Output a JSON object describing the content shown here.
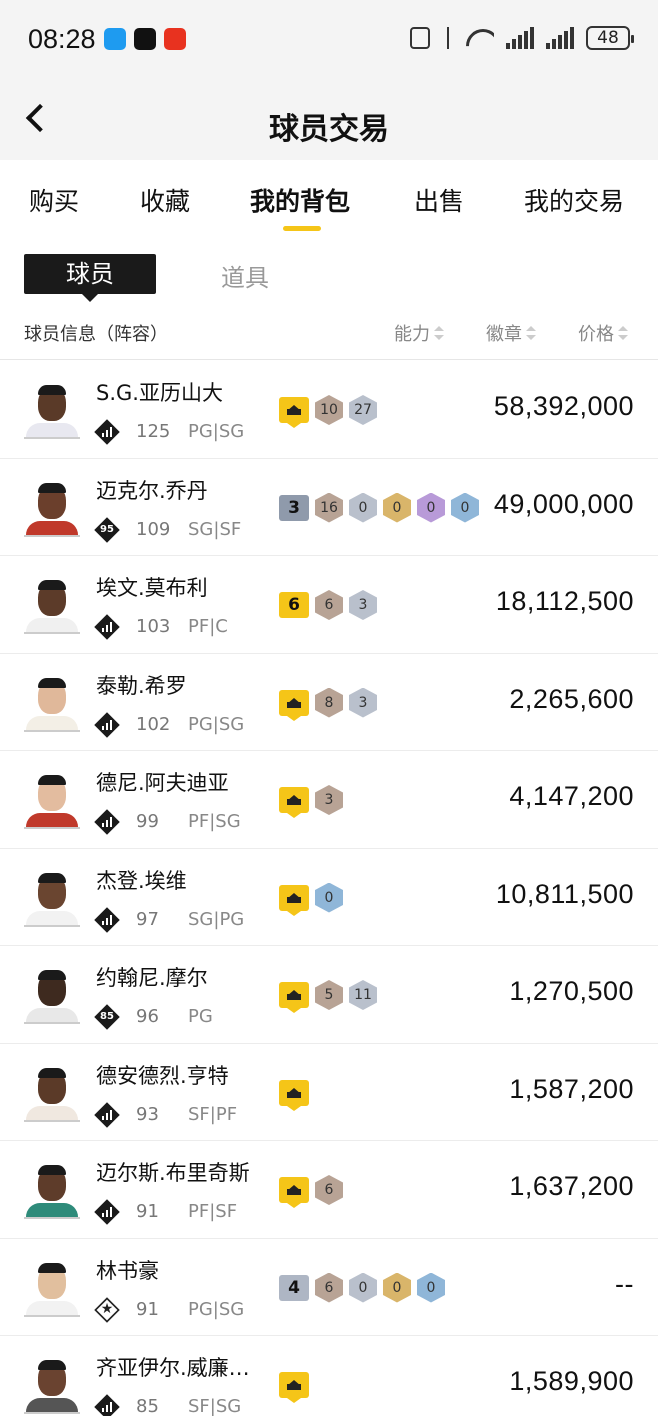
{
  "status_bar": {
    "time": "08:28",
    "battery": "48",
    "icons": [
      "message-app-icon",
      "tiktok-icon",
      "news-app-icon",
      "nfc-icon",
      "bluetooth-icon",
      "wifi-icon",
      "signal-icon",
      "signal-icon",
      "battery-icon"
    ]
  },
  "header": {
    "title": "球员交易",
    "back_icon": "chevron-left-icon"
  },
  "tabs": [
    {
      "label": "购买",
      "active": false
    },
    {
      "label": "收藏",
      "active": false
    },
    {
      "label": "我的背包",
      "active": true
    },
    {
      "label": "出售",
      "active": false
    },
    {
      "label": "我的交易",
      "active": false
    }
  ],
  "subtabs": {
    "players": "球员",
    "items": "道具",
    "selected": "球员"
  },
  "columns": {
    "info": "球员信息（阵容）",
    "ability": "能力",
    "badges": "徽章",
    "price": "价格"
  },
  "colors": {
    "accent": "#f5c518",
    "text": "#111111",
    "muted": "#888888",
    "divider": "#ececec"
  },
  "players": [
    {
      "name": "S.G.亚历山大",
      "ovr": "125",
      "pos": "PG|SG",
      "rank": "bars",
      "tier": "crown",
      "badges": [
        {
          "t": "bronze",
          "v": "10"
        },
        {
          "t": "silver",
          "v": "27"
        }
      ],
      "price": "58,392,000",
      "skin": "#5a3a28",
      "shirt": "#e8e8f0"
    },
    {
      "name": "迈克尔.乔丹",
      "ovr": "109",
      "pos": "SG|SF",
      "rank": "95",
      "tier": "3",
      "badges": [
        {
          "t": "bronze",
          "v": "16"
        },
        {
          "t": "silver",
          "v": "0"
        },
        {
          "t": "gold",
          "v": "0"
        },
        {
          "t": "purple",
          "v": "0"
        },
        {
          "t": "blue",
          "v": "0"
        }
      ],
      "price": "49,000,000",
      "skin": "#6b3f2c",
      "shirt": "#c0392b"
    },
    {
      "name": "埃文.莫布利",
      "ovr": "103",
      "pos": "PF|C",
      "rank": "bars",
      "tier": "6",
      "badges": [
        {
          "t": "bronze",
          "v": "6"
        },
        {
          "t": "silver",
          "v": "3"
        }
      ],
      "price": "18,112,500",
      "skin": "#5c3b29",
      "shirt": "#f0f0f0"
    },
    {
      "name": "泰勒.希罗",
      "ovr": "102",
      "pos": "PG|SG",
      "rank": "bars",
      "tier": "crown",
      "badges": [
        {
          "t": "bronze",
          "v": "8"
        },
        {
          "t": "silver",
          "v": "3"
        }
      ],
      "price": "2,265,600",
      "skin": "#e0b89a",
      "shirt": "#f3efe6"
    },
    {
      "name": "德尼.阿夫迪亚",
      "ovr": "99",
      "pos": "PF|SG",
      "rank": "bars",
      "tier": "crown",
      "badges": [
        {
          "t": "bronze",
          "v": "3"
        }
      ],
      "price": "4,147,200",
      "skin": "#e3bc9f",
      "shirt": "#c0392b"
    },
    {
      "name": "杰登.埃维",
      "ovr": "97",
      "pos": "SG|PG",
      "rank": "bars",
      "tier": "crown",
      "badges": [
        {
          "t": "blue",
          "v": "0"
        }
      ],
      "price": "10,811,500",
      "skin": "#6a4530",
      "shirt": "#f2f2f2"
    },
    {
      "name": "约翰尼.摩尔",
      "ovr": "96",
      "pos": "PG",
      "rank": "85",
      "tier": "crown",
      "badges": [
        {
          "t": "bronze",
          "v": "5"
        },
        {
          "t": "silver",
          "v": "11"
        }
      ],
      "price": "1,270,500",
      "skin": "#3e2a1f",
      "shirt": "#e8e8e8"
    },
    {
      "name": "德安德烈.亨特",
      "ovr": "93",
      "pos": "SF|PF",
      "rank": "bars",
      "tier": "crown",
      "badges": [],
      "price": "1,587,200",
      "skin": "#5b3a28",
      "shirt": "#f0e8e0"
    },
    {
      "name": "迈尔斯.布里奇斯",
      "ovr": "91",
      "pos": "PF|SF",
      "rank": "bars",
      "tier": "crown",
      "badges": [
        {
          "t": "bronze",
          "v": "6"
        }
      ],
      "price": "1,637,200",
      "skin": "#5e3c2a",
      "shirt": "#2e8b7a"
    },
    {
      "name": "林书豪",
      "ovr": "91",
      "pos": "PG|SG",
      "rank": "star",
      "tier": "4",
      "badges": [
        {
          "t": "bronze",
          "v": "6"
        },
        {
          "t": "silver",
          "v": "0"
        },
        {
          "t": "gold",
          "v": "0"
        },
        {
          "t": "blue",
          "v": "0"
        }
      ],
      "price": "--",
      "skin": "#e1bf9e",
      "shirt": "#f2f2f2"
    },
    {
      "name": "齐亚伊尔.威廉…",
      "ovr": "85",
      "pos": "SF|SG",
      "rank": "bars",
      "tier": "crown",
      "badges": [],
      "price": "1,589,900",
      "skin": "#6a4330",
      "shirt": "#555555"
    }
  ]
}
